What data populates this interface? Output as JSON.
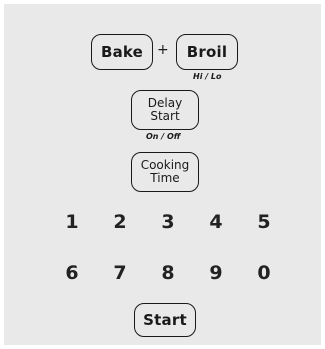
{
  "keypad": {
    "bake": "Bake",
    "plus": "+",
    "broil": "Broil",
    "broil_sub": "Hi / Lo",
    "delay_line1": "Delay",
    "delay_line2": "Start",
    "delay_sub": "On / Off",
    "cooking_line1": "Cooking",
    "cooking_line2": "Time",
    "digits_row1": [
      "1",
      "2",
      "3",
      "4",
      "5"
    ],
    "digits_row2": [
      "6",
      "7",
      "8",
      "9",
      "0"
    ],
    "start": "Start"
  }
}
